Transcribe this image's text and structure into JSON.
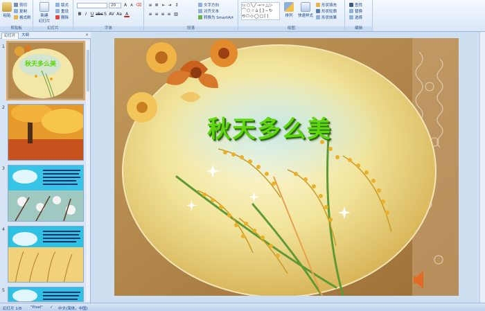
{
  "ribbon": {
    "groups": {
      "clipboard": "剪贴板",
      "slides": "幻灯片",
      "font": "字体",
      "paragraph": "段落",
      "drawing": "绘图",
      "editing": "编辑"
    },
    "clipboard": {
      "paste": "粘贴",
      "cut": "剪切",
      "copy": "复制",
      "format_painter": "格式刷"
    },
    "slides": {
      "new_slide": "新建\n幻灯片",
      "layout": "版式",
      "reset": "重设",
      "delete": "删除"
    },
    "font": {
      "font_name": "",
      "font_size": "20"
    },
    "paragraph": {
      "text_direction": "文字方向",
      "align_text": "对齐文本",
      "convert_smartart": "转换为 SmartArt"
    },
    "drawing": {
      "arrange": "排列",
      "quick_styles": "快速样式",
      "shape_fill": "形状填充",
      "shape_outline": "形状轮廓",
      "shape_effects": "形状效果"
    },
    "editing": {
      "find": "查找",
      "replace": "替换",
      "select": "选择"
    }
  },
  "leftpane": {
    "tabs": [
      "幻灯片",
      "大纲"
    ],
    "close": "×",
    "slide_numbers": [
      "1",
      "2",
      "3",
      "4",
      "5"
    ]
  },
  "slide": {
    "title": "秋天多么美"
  },
  "status": {
    "slide_of": "幻灯片 1/8",
    "theme": "\"Pixel\"",
    "language": "中文(简体，中国)"
  },
  "colors": {
    "ribbon_bg": "#dbe8f7",
    "selection": "#f7a23a",
    "title_green": "#5fd70f"
  }
}
